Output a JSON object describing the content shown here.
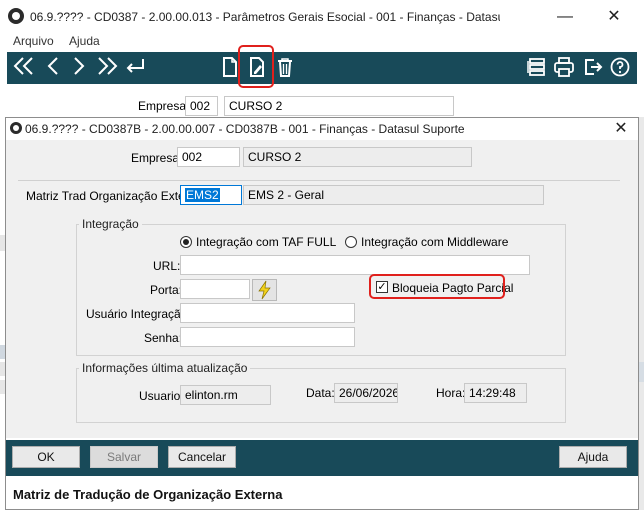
{
  "parent": {
    "title": "06.9.???? - CD0387 - 2.00.00.013 - Parâmetros Gerais Esocial - 001 - Finanças - Datasul S...",
    "menu": [
      "Arquivo",
      "Ajuda"
    ],
    "empresa_label": "Empresa:",
    "empresa_code": "002",
    "empresa_name": "CURSO 2"
  },
  "dialog": {
    "title": "06.9.???? - CD0387B - 2.00.00.007 - CD0387B - 001 - Finanças - Datasul Suporte",
    "empresa_label": "Empresa:",
    "empresa_code": "002",
    "empresa_name": "CURSO 2",
    "matriz_label": "Matriz Trad Organização Extern:",
    "matriz_code": "EMS2",
    "matriz_desc": "EMS 2 - Geral",
    "integracao": {
      "legend": "Integração",
      "radio_taf": "Integração com TAF FULL",
      "radio_middleware": "Integração com Middleware",
      "url_label": "URL:",
      "url_value": "",
      "porta_label": "Porta:",
      "porta_value": "",
      "bloqueia_label": "Bloqueia Pagto Parcial",
      "usuario_label": "Usuário Integração:",
      "usuario_value": "",
      "senha_label": "Senha:",
      "senha_value": ""
    },
    "atualizacao": {
      "legend": "Informações última atualização",
      "usuario_label": "Usuario:",
      "usuario_value": "elinton.rm",
      "data_label": "Data:",
      "data_value": "26/06/2026",
      "hora_label": "Hora:",
      "hora_value": "14:29:48"
    },
    "buttons": {
      "ok": "OK",
      "salvar": "Salvar",
      "cancelar": "Cancelar",
      "ajuda": "Ajuda"
    },
    "status_text": "Matriz de Tradução de Organização Externa"
  },
  "colors": {
    "toolbar": "#184a59",
    "highlight": "#e0201c",
    "selection": "#0078d7"
  }
}
